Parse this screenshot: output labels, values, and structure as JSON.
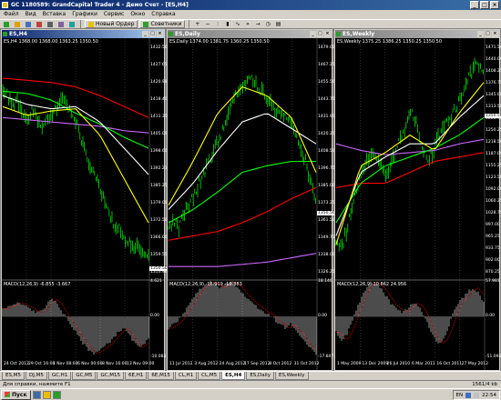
{
  "app": {
    "title": "GC 1180589: GrandCapital Trader 4 - Демо Счет - [ES,H4]"
  },
  "menu": [
    "Файл",
    "Вид",
    "Вставка",
    "Графики",
    "Сервис",
    "Окно",
    "Справка"
  ],
  "toolbar": {
    "new_order": "Новый Ордер",
    "advisors": "Советники",
    "icons": [
      "new-chart-icon",
      "profiles-icon",
      "market-watch-icon",
      "data-window-icon",
      "navigator-icon",
      "terminal-icon",
      "tester-icon",
      "zoom-in-icon",
      "zoom-out-icon",
      "bar-chart-icon",
      "candle-chart-icon",
      "line-chart-icon",
      "autoscroll-icon",
      "shift-icon",
      "periods-icon",
      "templates-icon"
    ]
  },
  "windows": [
    {
      "title": "ES,H4",
      "info": "ES,H4 1368.00 1368.00 1363.25 1350.50",
      "macd_label": "MACD(12,26,9) -6.855 -3.667",
      "price_labels": [
        "1432.50",
        "1427.65",
        "1420.98",
        "1418.40",
        "1411.35",
        "1405.00",
        "1398.60",
        "1392.23",
        "1385.25",
        "1379.00",
        "1372.50",
        "1366.00",
        "1359.55",
        "1353.96"
      ],
      "current_price": "1350.50",
      "macd_scale": [
        "4.621",
        "0.00",
        "-10.083"
      ],
      "dates": [
        "24 Oct 2012",
        "29 Oct 16:00",
        "1 Nov 08:00",
        "6 Nov 00:00",
        "8 Nov 16:00",
        "13 Nov 09:00"
      ],
      "active": true
    },
    {
      "title": "ES,Daily",
      "info": "ES,Daily 1374.00 1381.75 1360.25 1350.50",
      "macd_label": "MACD(12,26,9) -16.919 -10.883",
      "price_labels": [
        "1479.00",
        "1467.25",
        "1455.50",
        "1443.75",
        "1431.95",
        "1420.25",
        "1408.50",
        "1396.75",
        "1385.00",
        "1373.25",
        "1361.50",
        "1349.75",
        "1338.00",
        "1326.25"
      ],
      "current_price": "1350.50",
      "macd_scale": [
        "18.146",
        "0.00",
        "-17.847"
      ],
      "dates": [
        "11 Jul 2012",
        "3 Aug 2012",
        "24 Aug 2012",
        "17 Sep 2012",
        "8 Oct 2012",
        "31 Oct 2012"
      ],
      "active": false
    },
    {
      "title": "ES,Weekly",
      "info": "ES,Weekly 1375.25 1386.25 1350.25 1350.50",
      "macd_label": "MACD(12,26,9) 10.862 24.956",
      "price_labels": [
        "1471.50",
        "1440.00",
        "1408.25",
        "1376.75",
        "1345.00",
        "1313.50",
        "1281.75",
        "1250.25",
        "1218.50",
        "1187.00",
        "1155.25",
        "1123.50",
        "1092.00",
        "1060.25",
        "1028.75",
        "997.00",
        "965.25",
        "933.75",
        "902.00",
        "870.25"
      ],
      "current_price": "1350.50",
      "macd_scale": [
        "57.981",
        "0.00",
        "-51.093"
      ],
      "dates": [
        "1 May 2009",
        "13 Dec 2009",
        "26 Jul 2010",
        "6 Mar 2011",
        "16 Oct 2011",
        "27 May 2012"
      ],
      "active": false
    }
  ],
  "tabs": [
    "ES,M5",
    "DJ,M5",
    "GC,H1",
    "GC,M5",
    "GC,M15",
    "6E,H1",
    "6E,M15",
    "CL,H1",
    "CL,M5",
    "ES,H4",
    "ES,Daily",
    "ES,Weekly"
  ],
  "active_tab": "ES,H4",
  "status": {
    "help": "Для справки, нажмите F1",
    "connection": "1561/4 kb"
  },
  "taskbar": {
    "start": "Пуск",
    "lang": "EN",
    "time": "22:54"
  },
  "colors": {
    "candle": "#00ff00",
    "ma_red": "#ff0000",
    "ma_green": "#00ff00",
    "ma_white": "#ffffff",
    "ma_yellow": "#ffff00",
    "ma_purple": "#cc66ff",
    "macd_bar": "#c0c0c0",
    "macd_signal": "#ff0000"
  }
}
